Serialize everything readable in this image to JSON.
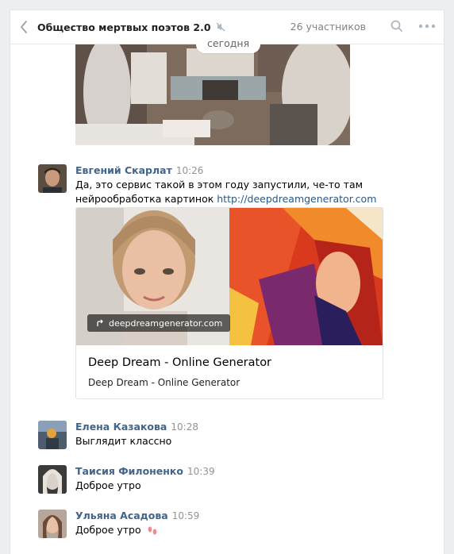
{
  "header": {
    "title": "Общество мертвых поэтов 2.0",
    "members": "26 участников"
  },
  "date_separator": "сегодня",
  "messages": [
    {
      "author": "Евгений Скарлат",
      "time": "10:26",
      "text": "Да, это сервис такой в этом году запустили, че-то там нейрообработка картинок ",
      "link": "http://deepdreamgenerator.com",
      "card": {
        "domain": "deepdreamgenerator.com",
        "title": "Deep Dream - Online Generator",
        "subtitle": "Deep Dream - Online Generator"
      }
    },
    {
      "author": "Елена Казакова",
      "time": "10:28",
      "text": "Выглядит классно"
    },
    {
      "author": "Таисия Филоненко",
      "time": "10:39",
      "text": "Доброе утро"
    },
    {
      "author": "Ульяна Асадова",
      "time": "10:59",
      "text": "Доброе утро",
      "emoji": "footprints-icon"
    }
  ],
  "colors": {
    "author": "#42648b",
    "link": "#2a5885",
    "background": "#edeef0"
  }
}
